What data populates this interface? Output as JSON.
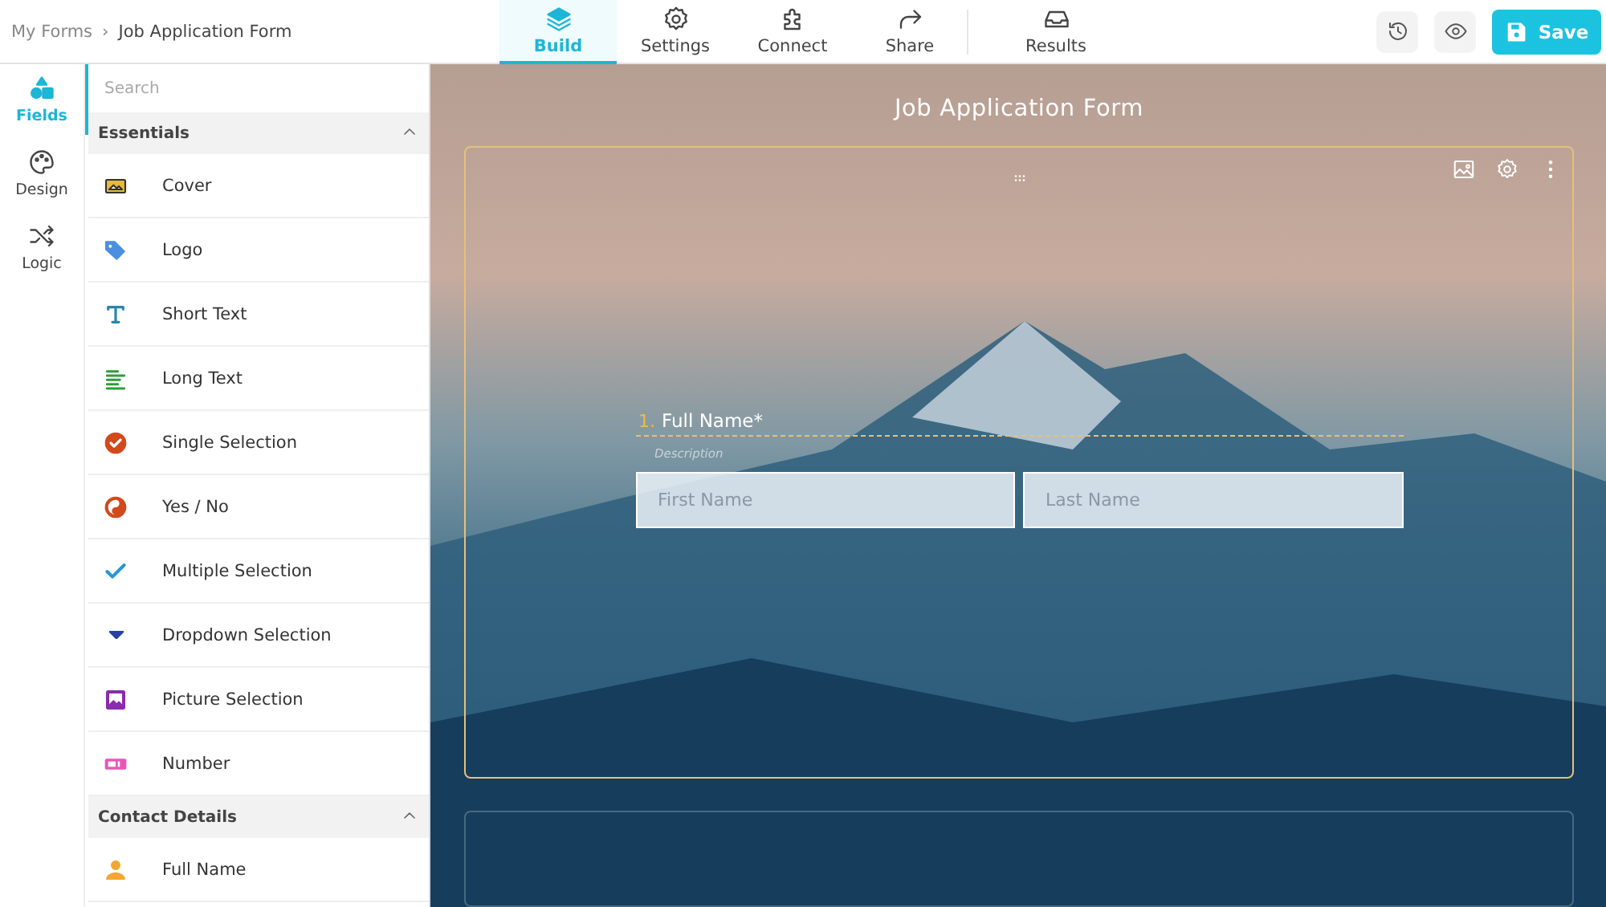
{
  "breadcrumb": {
    "parent": "My Forms",
    "separator": "›",
    "current": "Job Application Form"
  },
  "tabs": [
    {
      "label": "Build",
      "selected": true
    },
    {
      "label": "Settings",
      "selected": false
    },
    {
      "label": "Connect",
      "selected": false
    },
    {
      "label": "Share",
      "selected": false
    },
    {
      "label": "Results",
      "selected": false
    }
  ],
  "save_button": {
    "label": "Save"
  },
  "rail": [
    {
      "label": "Fields",
      "selected": true
    },
    {
      "label": "Design",
      "selected": false
    },
    {
      "label": "Logic",
      "selected": false
    }
  ],
  "search": {
    "placeholder": "Search"
  },
  "sections": [
    {
      "title": "Essentials",
      "expanded": true,
      "items": [
        {
          "label": "Cover",
          "kind": "cover"
        },
        {
          "label": "Logo",
          "kind": "logo"
        },
        {
          "label": "Short Text",
          "kind": "short-text"
        },
        {
          "label": "Long Text",
          "kind": "long-text"
        },
        {
          "label": "Single Selection",
          "kind": "single"
        },
        {
          "label": "Yes / No",
          "kind": "yesno"
        },
        {
          "label": "Multiple Selection",
          "kind": "multiple"
        },
        {
          "label": "Dropdown Selection",
          "kind": "dropdown"
        },
        {
          "label": "Picture Selection",
          "kind": "picture"
        },
        {
          "label": "Number",
          "kind": "number"
        }
      ]
    },
    {
      "title": "Contact Details",
      "expanded": true,
      "items": [
        {
          "label": "Full Name",
          "kind": "person"
        }
      ]
    }
  ],
  "form": {
    "title": "Job Application Form",
    "question": {
      "number": "1.",
      "title": "Full Name*",
      "description_placeholder": "Description",
      "fields": [
        {
          "placeholder": "First Name"
        },
        {
          "placeholder": "Last Name"
        }
      ]
    }
  }
}
